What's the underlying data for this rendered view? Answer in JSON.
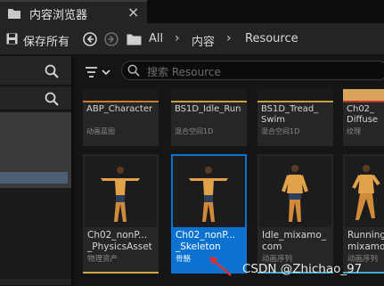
{
  "tab": {
    "title": "内容浏览器",
    "close": "×"
  },
  "toolbar": {
    "save_label": "保存所有",
    "breadcrumbs": [
      "All",
      "内容",
      "Resource"
    ]
  },
  "search": {
    "placeholder": "搜索 Resource"
  },
  "row1": [
    {
      "name": "ABP_Character",
      "name2": "",
      "type": "动画蓝图",
      "accent": "#c97a30"
    },
    {
      "name": "BS1D_Idle_Run",
      "name2": "",
      "type": "混合空间1D",
      "accent": "#c6a03a"
    },
    {
      "name": "BS1D_Tread_",
      "name2": "Swim",
      "type": "混合空间1D",
      "accent": "#c6a03a"
    },
    {
      "name": "Ch02_",
      "name2": "Diffuse",
      "type": "纹理",
      "accent": "#b0392e"
    }
  ],
  "row2": [
    {
      "name": "Ch02_nonP...",
      "name2": "_PhysicsAsset",
      "type": "物理资产",
      "accent": "#d2a440",
      "selected": false
    },
    {
      "name": "Ch02_nonP...",
      "name2": "_Skeleton",
      "type": "骨骼",
      "accent": "#5ab0ff",
      "selected": true
    },
    {
      "name": "Idle_mixamo_",
      "name2": "com",
      "type": "动画序列",
      "accent": "#44a8d0",
      "selected": false
    },
    {
      "name": "Running",
      "name2": "mixamo_",
      "type": "动画序列",
      "accent": "#44a8d0",
      "selected": false
    }
  ],
  "watermark": "CSDN @Zhichao_97",
  "colors": {
    "selection": "#0c72d2",
    "annotation_arrow": "#e03030"
  }
}
